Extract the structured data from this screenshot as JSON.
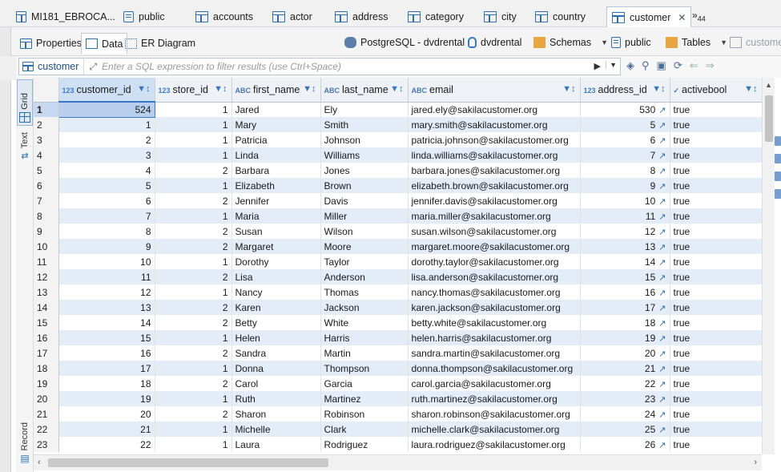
{
  "editor_tabs": [
    {
      "label": "MI181_EBROCA...",
      "icon": "sql-editor-icon"
    },
    {
      "label": "public",
      "icon": "schema-icon"
    },
    {
      "label": "accounts",
      "icon": "table-icon"
    },
    {
      "label": "actor",
      "icon": "table-icon"
    },
    {
      "label": "address",
      "icon": "table-icon"
    },
    {
      "label": "category",
      "icon": "table-icon"
    },
    {
      "label": "city",
      "icon": "table-icon"
    },
    {
      "label": "country",
      "icon": "table-icon"
    },
    {
      "label": "customer",
      "icon": "table-icon",
      "active": true
    }
  ],
  "more_tabs": {
    "symbol": "»",
    "count": "44"
  },
  "sub_tabs": {
    "properties": "Properties",
    "data": "Data",
    "er": "ER Diagram"
  },
  "breadcrumb": {
    "connection": "PostgreSQL - dvdrental",
    "database": "dvdrental",
    "schemas": "Schemas",
    "schema": "public",
    "tables": "Tables",
    "table": "customer"
  },
  "filter": {
    "table_name": "customer",
    "placeholder": "Enter a SQL expression to filter results (use Ctrl+Space)"
  },
  "side_panel": {
    "grid": "Grid",
    "text": "Text",
    "record": "Record"
  },
  "columns": [
    {
      "type": "123",
      "name": "customer_id"
    },
    {
      "type": "123",
      "name": "store_id"
    },
    {
      "type": "ABC",
      "name": "first_name"
    },
    {
      "type": "ABC",
      "name": "last_name"
    },
    {
      "type": "ABC",
      "name": "email"
    },
    {
      "type": "123",
      "name": "address_id"
    },
    {
      "type": "✓",
      "name": "activebool"
    }
  ],
  "rows": [
    [
      "1",
      "524",
      "1",
      "Jared",
      "Ely",
      "jared.ely@sakilacustomer.org",
      "530",
      "true"
    ],
    [
      "2",
      "1",
      "1",
      "Mary",
      "Smith",
      "mary.smith@sakilacustomer.org",
      "5",
      "true"
    ],
    [
      "3",
      "2",
      "1",
      "Patricia",
      "Johnson",
      "patricia.johnson@sakilacustomer.org",
      "6",
      "true"
    ],
    [
      "4",
      "3",
      "1",
      "Linda",
      "Williams",
      "linda.williams@sakilacustomer.org",
      "7",
      "true"
    ],
    [
      "5",
      "4",
      "2",
      "Barbara",
      "Jones",
      "barbara.jones@sakilacustomer.org",
      "8",
      "true"
    ],
    [
      "6",
      "5",
      "1",
      "Elizabeth",
      "Brown",
      "elizabeth.brown@sakilacustomer.org",
      "9",
      "true"
    ],
    [
      "7",
      "6",
      "2",
      "Jennifer",
      "Davis",
      "jennifer.davis@sakilacustomer.org",
      "10",
      "true"
    ],
    [
      "8",
      "7",
      "1",
      "Maria",
      "Miller",
      "maria.miller@sakilacustomer.org",
      "11",
      "true"
    ],
    [
      "9",
      "8",
      "2",
      "Susan",
      "Wilson",
      "susan.wilson@sakilacustomer.org",
      "12",
      "true"
    ],
    [
      "10",
      "9",
      "2",
      "Margaret",
      "Moore",
      "margaret.moore@sakilacustomer.org",
      "13",
      "true"
    ],
    [
      "11",
      "10",
      "1",
      "Dorothy",
      "Taylor",
      "dorothy.taylor@sakilacustomer.org",
      "14",
      "true"
    ],
    [
      "12",
      "11",
      "2",
      "Lisa",
      "Anderson",
      "lisa.anderson@sakilacustomer.org",
      "15",
      "true"
    ],
    [
      "13",
      "12",
      "1",
      "Nancy",
      "Thomas",
      "nancy.thomas@sakilacustomer.org",
      "16",
      "true"
    ],
    [
      "14",
      "13",
      "2",
      "Karen",
      "Jackson",
      "karen.jackson@sakilacustomer.org",
      "17",
      "true"
    ],
    [
      "15",
      "14",
      "2",
      "Betty",
      "White",
      "betty.white@sakilacustomer.org",
      "18",
      "true"
    ],
    [
      "16",
      "15",
      "1",
      "Helen",
      "Harris",
      "helen.harris@sakilacustomer.org",
      "19",
      "true"
    ],
    [
      "17",
      "16",
      "2",
      "Sandra",
      "Martin",
      "sandra.martin@sakilacustomer.org",
      "20",
      "true"
    ],
    [
      "18",
      "17",
      "1",
      "Donna",
      "Thompson",
      "donna.thompson@sakilacustomer.org",
      "21",
      "true"
    ],
    [
      "19",
      "18",
      "2",
      "Carol",
      "Garcia",
      "carol.garcia@sakilacustomer.org",
      "22",
      "true"
    ],
    [
      "20",
      "19",
      "1",
      "Ruth",
      "Martinez",
      "ruth.martinez@sakilacustomer.org",
      "23",
      "true"
    ],
    [
      "21",
      "20",
      "2",
      "Sharon",
      "Robinson",
      "sharon.robinson@sakilacustomer.org",
      "24",
      "true"
    ],
    [
      "22",
      "21",
      "1",
      "Michelle",
      "Clark",
      "michelle.clark@sakilacustomer.org",
      "25",
      "true"
    ],
    [
      "23",
      "22",
      "1",
      "Laura",
      "Rodriguez",
      "laura.rodriguez@sakilacustomer.org",
      "26",
      "true"
    ]
  ],
  "colors": {
    "accent": "#3a78c6",
    "row_alt": "#e3ecf7",
    "header": "#eef2f7"
  }
}
